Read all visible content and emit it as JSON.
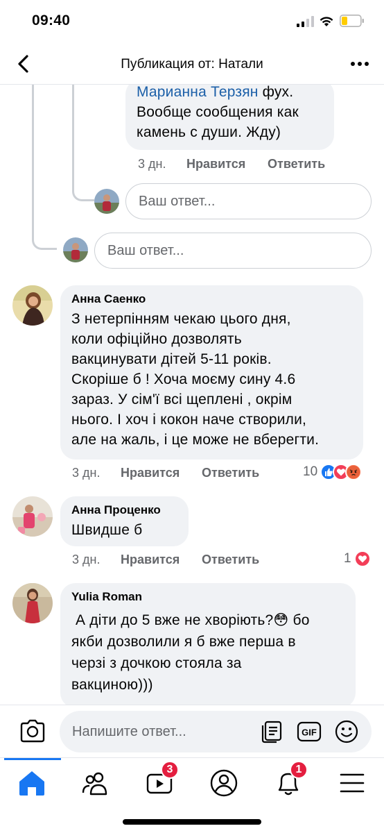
{
  "status_bar": {
    "time": "09:40"
  },
  "header": {
    "title": "Публикация от: Натали"
  },
  "comments": {
    "first_reply": {
      "mention": "Марианна Терзян",
      "text_lines": [
        " фух.",
        "Вообще сообщения как",
        "камень с души. Жду)"
      ],
      "time": "3 дн.",
      "like": "Нравится",
      "reply": "Ответить"
    },
    "reply_placeholder": "Ваш ответ...",
    "reply_placeholder_2": "Ваш ответ...",
    "anna_saenko": {
      "author": "Анна Саенко",
      "text_lines": [
        "З нетерпінням чекаю цього дня,",
        "коли офіційно дозволять",
        "вакцинувати дітей 5-11 років.",
        "Скоріше б !  Хоча моєму сину 4.6",
        "зараз.  У сім'ї всі щеплені , окрім",
        "нього. І хоч і кокон наче створили,",
        "але на жаль, і це може не вберегти."
      ],
      "time": "3 дн.",
      "like": "Нравится",
      "reply": "Ответить",
      "reactions_count": "10"
    },
    "anna_protsenko": {
      "author": "Анна Проценко",
      "text": "Швидше б",
      "time": "3 дн.",
      "like": "Нравится",
      "reply": "Ответить",
      "reactions_count": "1"
    },
    "yulia_roman": {
      "author": "Yulia Roman",
      "text_lines": [
        " А діти до 5 вже не хворіють?😳 бо",
        "якби дозволили я б вже перша в",
        "черзі з дочкою стояла за",
        "вакциною)))"
      ]
    }
  },
  "composer": {
    "placeholder": "Напишите ответ..."
  },
  "tabbar": {
    "video_badge": "3",
    "notifications_badge": "1"
  },
  "colors": {
    "accent": "#1877f2",
    "badge": "#e41e3f",
    "bubble": "#f0f2f5",
    "like": "#1877f2",
    "love": "#f33e58",
    "angry": "#f7714b"
  }
}
